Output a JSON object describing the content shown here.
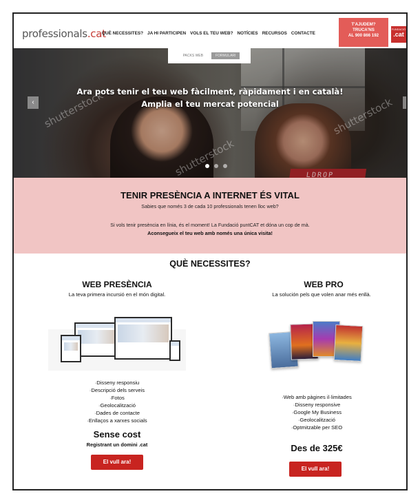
{
  "header": {
    "logo": {
      "text": "professionals",
      "accent": ".cat"
    },
    "nav": [
      "QUÈ NECESSITES?",
      "JA HI PARTICIPEN",
      "VOLS EL TEU WEB?",
      "NOTÍCIES",
      "RECURSOS",
      "CONTACTE"
    ],
    "help_cta": {
      "line1": "T'AJUDEM?",
      "line2": "TRUCA'NS",
      "line3": "AL 900 866 192"
    },
    "foundation_logo": {
      "line1": "FUNDACIÓ",
      "line2": ".cat"
    }
  },
  "subtabs": [
    "PACKS WEB",
    "FORMULARI"
  ],
  "hero": {
    "line1": "Ara pots tenir el teu web fàcilment, ràpidament i en català!",
    "line2": "Amplia el teu mercat potencial",
    "watermark": "shutterstock",
    "laptop_text": "LDROP",
    "slides": 3,
    "active_slide": 1
  },
  "band": {
    "title": "TENIR PRESÈNCIA A INTERNET ÉS VITAL",
    "subtitle": "Sabies que només 3 de cada 10 professionals tenen lloc web?",
    "paragraph": "Si vols tenir presència en línia, és el moment! La Fundació puntCAT et dóna un cop de mà.",
    "emphasis": "Aconsegueix el teu web amb només una única visita!"
  },
  "services": {
    "title": "QUÈ NECESSITES?",
    "plans": [
      {
        "name": "WEB PRESÈNCIA",
        "tagline": "La teva primera incursió en el món digital.",
        "features": [
          "·Disseny responsiu",
          "·Descripció dels serveis",
          "·Fotos",
          "·Geolocalització",
          "·Dades de contacte",
          "·Enllaços a xarxes socials"
        ],
        "price": "Sense cost",
        "price_note": "Registrant un domini .cat",
        "button": "El vull ara!"
      },
      {
        "name": "WEB PRO",
        "tagline": "La solución pels que volen anar més enllà.",
        "features": [
          "·Web amb pàgines il·limitades",
          "·Disseny responsive",
          "·Google My Business",
          "·Geolocalització",
          "·Optmitzable per SEO"
        ],
        "price": "Des de 325€",
        "price_note": "",
        "button": "El vull ara!"
      }
    ]
  },
  "colors": {
    "accent": "#c82420",
    "band": "#f1c5c4",
    "help_cta": "#e35c58"
  }
}
